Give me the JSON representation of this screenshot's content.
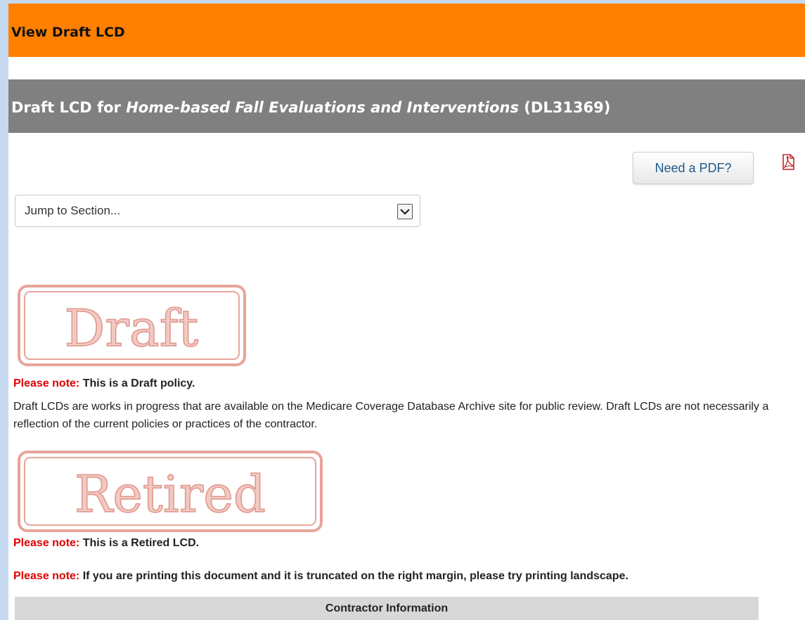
{
  "header": {
    "title": "View Draft LCD"
  },
  "lcd_title": {
    "prefix": "Draft LCD for ",
    "name": "Home-based Fall Evaluations and Interventions",
    "id": "(DL31369)"
  },
  "pdf": {
    "button_label": "Need a PDF?",
    "icon": "pdf-icon"
  },
  "jump": {
    "selected": "Jump to Section..."
  },
  "stamps": {
    "draft": "Draft",
    "retired": "Retired"
  },
  "notes": {
    "label": "Please note:",
    "draft": " This is a Draft policy.",
    "draft_paragraph": "Draft LCDs are works in progress that are available on the Medicare Coverage Database Archive site for public review. Draft LCDs are not necessarily a reflection of the current policies or practices of the contractor.",
    "retired": " This is a Retired LCD.",
    "printing": " If you are printing this document and it is truncated on the right margin, please try printing landscape."
  },
  "section": {
    "contractor_information": "Contractor Information"
  },
  "colors": {
    "orange": "#ff8000",
    "gray": "#808080",
    "note_red": "#e00000",
    "stamp": "#e8a49a"
  }
}
